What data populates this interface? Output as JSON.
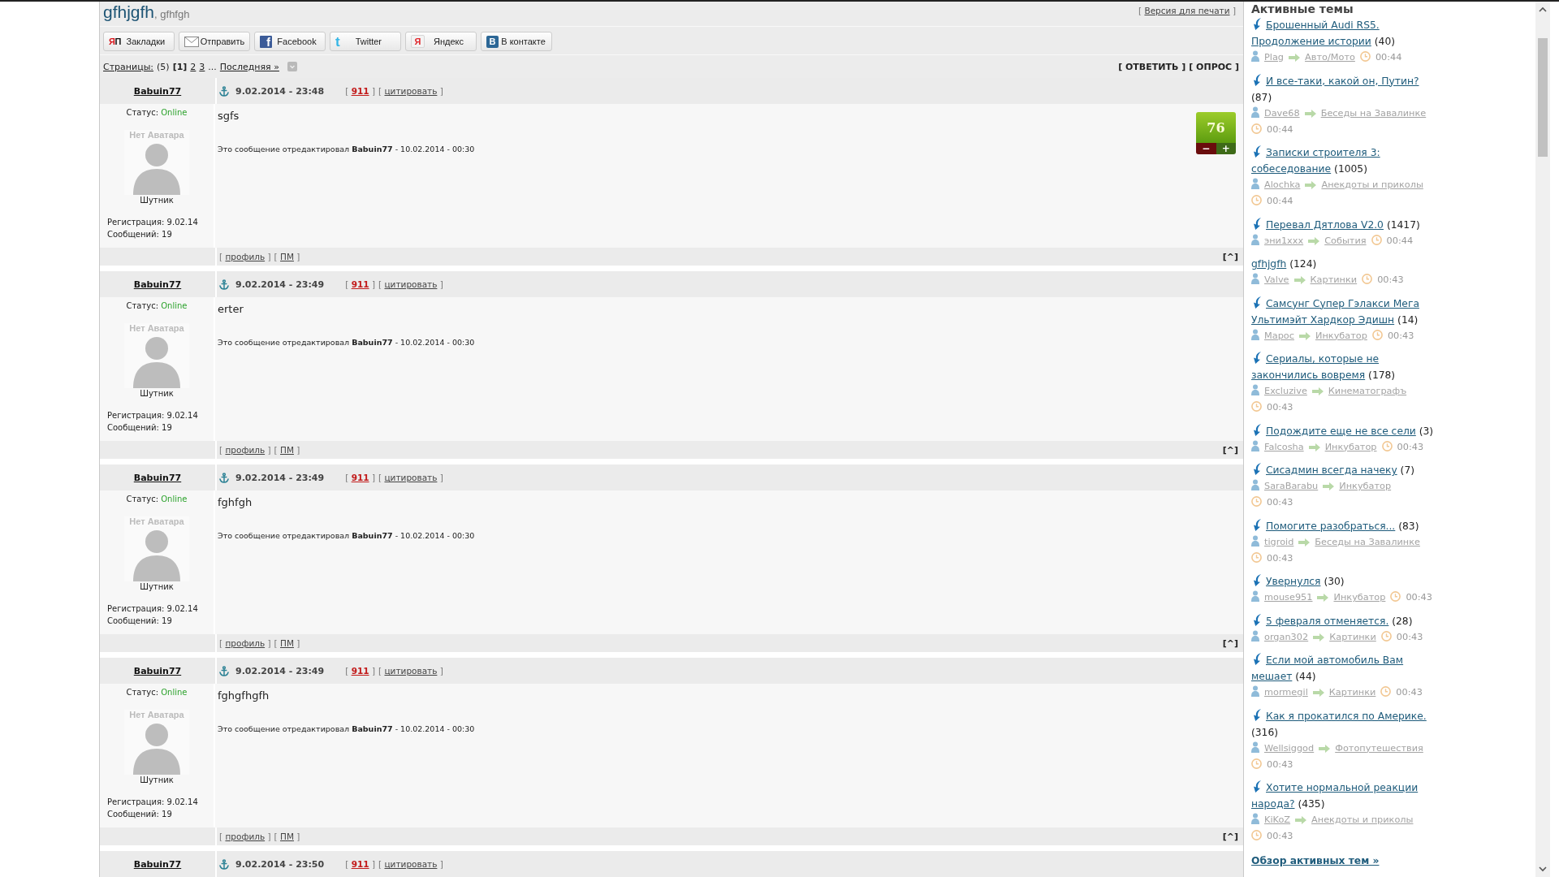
{
  "header": {
    "title": "gfhjgfh",
    "subtitle": ", gfhfgh",
    "print_link": {
      "open": "[",
      "label": "Версия для печати",
      "close": "]"
    }
  },
  "share_buttons": [
    {
      "kind": "bookmarks",
      "glyph": "ЯП",
      "label": "Закладки"
    },
    {
      "kind": "mail",
      "label": "Отправить"
    },
    {
      "kind": "facebook",
      "glyph": "f",
      "label": "Facebook"
    },
    {
      "kind": "twitter",
      "glyph": "t",
      "label": "Twitter"
    },
    {
      "kind": "yandex",
      "glyph": "Я",
      "label": "Яндекс"
    },
    {
      "kind": "vk",
      "glyph": "B",
      "label": "В контакте"
    }
  ],
  "pagination": {
    "label": "Страницы:",
    "total": "(5)",
    "pages": [
      {
        "label": "[1]",
        "selected": true
      },
      {
        "label": "2",
        "selected": false
      },
      {
        "label": "3",
        "selected": false
      }
    ],
    "ellipsis": "...",
    "last": "Последняя »"
  },
  "thread_actions": [
    "[ ОТВЕТИТЬ ]",
    "[ ОПРОС ]"
  ],
  "posts": [
    {
      "author": "Babuin77",
      "date": "9.02.2014 - 23:48",
      "links": [
        {
          "kind": "report",
          "open": "[",
          "label": "911",
          "close": "]"
        },
        {
          "kind": "quote",
          "open": "[",
          "label": "цитировать",
          "close": "]"
        }
      ],
      "status_label": "Статус:",
      "status": "Online",
      "online": true,
      "avatar_text": "Нет Аватара",
      "rank": "Шутник",
      "registration": "Регистрация: 9.02.14",
      "messages": "Сообщений: 19",
      "text": "sgfs",
      "edit_note": "Это сообщение отредактировал **Babuin77** - 10.02.2014 - 00:30",
      "rating": {
        "value": "76",
        "minus": "−",
        "plus": "+"
      },
      "footer_links": [
        {
          "open": "[",
          "label": "профиль",
          "close": "]"
        },
        {
          "open": "[",
          "label": "ПМ",
          "close": "]"
        }
      ],
      "top_link": "[^]"
    },
    {
      "author": "Babuin77",
      "date": "9.02.2014 - 23:49",
      "links": [
        {
          "kind": "report",
          "open": "[",
          "label": "911",
          "close": "]"
        },
        {
          "kind": "quote",
          "open": "[",
          "label": "цитировать",
          "close": "]"
        }
      ],
      "status_label": "Статус:",
      "status": "Online",
      "online": true,
      "avatar_text": "Нет Аватара",
      "rank": "Шутник",
      "registration": "Регистрация: 9.02.14",
      "messages": "Сообщений: 19",
      "text": "erter",
      "edit_note": "Это сообщение отредактировал **Babuin77** - 10.02.2014 - 00:30",
      "footer_links": [
        {
          "open": "[",
          "label": "профиль",
          "close": "]"
        },
        {
          "open": "[",
          "label": "ПМ",
          "close": "]"
        }
      ],
      "top_link": "[^]"
    },
    {
      "author": "Babuin77",
      "date": "9.02.2014 - 23:49",
      "links": [
        {
          "kind": "report",
          "open": "[",
          "label": "911",
          "close": "]"
        },
        {
          "kind": "quote",
          "open": "[",
          "label": "цитировать",
          "close": "]"
        }
      ],
      "status_label": "Статус:",
      "status": "Online",
      "online": true,
      "avatar_text": "Нет Аватара",
      "rank": "Шутник",
      "registration": "Регистрация: 9.02.14",
      "messages": "Сообщений: 19",
      "text": "fghfgh",
      "edit_note": "Это сообщение отредактировал **Babuin77** - 10.02.2014 - 00:30",
      "footer_links": [
        {
          "open": "[",
          "label": "профиль",
          "close": "]"
        },
        {
          "open": "[",
          "label": "ПМ",
          "close": "]"
        }
      ],
      "top_link": "[^]"
    },
    {
      "author": "Babuin77",
      "date": "9.02.2014 - 23:49",
      "links": [
        {
          "kind": "report",
          "open": "[",
          "label": "911",
          "close": "]"
        },
        {
          "kind": "quote",
          "open": "[",
          "label": "цитировать",
          "close": "]"
        }
      ],
      "status_label": "Статус:",
      "status": "Online",
      "online": true,
      "avatar_text": "Нет Аватара",
      "rank": "Шутник",
      "registration": "Регистрация: 9.02.14",
      "messages": "Сообщений: 19",
      "text": "fghgfhgfh",
      "edit_note": "Это сообщение отредактировал **Babuin77** - 10.02.2014 - 00:30",
      "footer_links": [
        {
          "open": "[",
          "label": "профиль",
          "close": "]"
        },
        {
          "open": "[",
          "label": "ПМ",
          "close": "]"
        }
      ],
      "top_link": "[^]"
    },
    {
      "author": "Babuin77",
      "date": "9.02.2014 - 23:50",
      "links": [
        {
          "kind": "report",
          "open": "[",
          "label": "911",
          "close": "]"
        },
        {
          "kind": "quote",
          "open": "[",
          "label": "цитировать",
          "close": "]"
        }
      ]
    }
  ],
  "active_topics": {
    "title": "Активные темы",
    "items": [
      {
        "unread": true,
        "title": "Брошенный Audi RS5. Продолжение истории",
        "count": "(40)",
        "author": "Plag",
        "forum": "Авто/Мото",
        "time": "00:44"
      },
      {
        "unread": true,
        "title": "И все-таки, какой он, Путин?",
        "count": "(87)",
        "author": "Dave68",
        "forum": "Беседы на Завалинке",
        "time": "00:44"
      },
      {
        "unread": true,
        "title": "Записки строителя 3: собеседование",
        "count": "(1005)",
        "author": "Alochka",
        "forum": "Анекдоты и приколы",
        "time": "00:44"
      },
      {
        "unread": true,
        "title": "Перевал Дятлова V2.0",
        "count": "(1417)",
        "author": "эни1xxx",
        "forum": "События",
        "time": "00:44"
      },
      {
        "unread": false,
        "title": "gfhjgfh",
        "count": "(124)",
        "author": "Valve",
        "forum": "Картинки",
        "time": "00:43"
      },
      {
        "unread": true,
        "title": "Самсунг Супер Гэлакси Мега Ультимэйт Хардкор Эдишн",
        "count": "(14)",
        "author": "Марос",
        "forum": "Инкубатор",
        "time": "00:43"
      },
      {
        "unread": true,
        "title": "Сериалы, которые не закончились вовремя",
        "count": "(178)",
        "author": "Excluzive",
        "forum": "Кинематографъ",
        "time": "00:43"
      },
      {
        "unread": true,
        "title": "Подождите еще не все сели",
        "count": "(3)",
        "author": "Falcosha",
        "forum": "Инкубатор",
        "time": "00:43"
      },
      {
        "unread": true,
        "title": "Сисадмин всегда начеку",
        "count": "(7)",
        "author": "SaraBarabu",
        "forum": "Инкубатор",
        "time": "00:43"
      },
      {
        "unread": true,
        "title": "Помогите разобраться...",
        "count": "(83)",
        "author": "tigroid",
        "forum": "Беседы на Завалинке",
        "time": "00:43"
      },
      {
        "unread": true,
        "title": "Увернулся",
        "count": "(30)",
        "author": "mouse951",
        "forum": "Инкубатор",
        "time": "00:43"
      },
      {
        "unread": true,
        "title": "5 февраля отменяется.",
        "count": "(28)",
        "author": "organ302",
        "forum": "Картинки",
        "time": "00:43"
      },
      {
        "unread": true,
        "title": "Если мой автомобиль Вам мешает",
        "count": "(44)",
        "author": "mormegil",
        "forum": "Картинки",
        "time": "00:43"
      },
      {
        "unread": true,
        "title": "Как я прокатился по Америке.",
        "count": "(316)",
        "author": "Wellsiggod",
        "forum": "Фотопутешествия",
        "time": "00:43"
      },
      {
        "unread": true,
        "title": "Хотите нормальной реакции народа?",
        "count": "(435)",
        "author": "KiKoZ",
        "forum": "Анекдоты и приколы",
        "time": "00:43"
      }
    ],
    "more_link": "Обзор активных тем »"
  }
}
